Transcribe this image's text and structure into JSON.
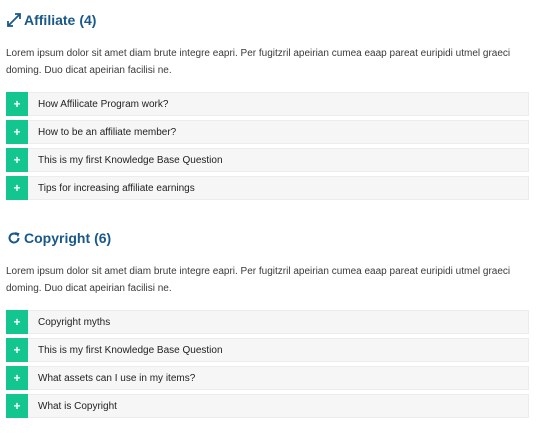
{
  "colors": {
    "accent": "#13c58e",
    "heading": "#19588a",
    "row_bg": "#f6f6f6"
  },
  "sections": [
    {
      "icon": "expand-arrows-icon",
      "title": "Affiliate",
      "count": "(4)",
      "description": "Lorem ipsum dolor sit amet diam brute integre eapri. Per fugitzril apeirian cumea eaap pareat euripidi utmel graeci doming. Duo dicat apeirian facilisi ne.",
      "questions": [
        {
          "toggle": "+",
          "label": "How Affilicate Program work?"
        },
        {
          "toggle": "+",
          "label": "How to be an affiliate member?"
        },
        {
          "toggle": "+",
          "label": "This is my first Knowledge Base Question"
        },
        {
          "toggle": "+",
          "label": "Tips for increasing affiliate earnings"
        }
      ]
    },
    {
      "icon": "refresh-icon",
      "title": "Copyright",
      "count": "(6)",
      "description": "Lorem ipsum dolor sit amet diam brute integre eapri. Per fugitzril apeirian cumea eaap pareat euripidi utmel graeci doming. Duo dicat apeirian facilisi ne.",
      "questions": [
        {
          "toggle": "+",
          "label": "Copyright myths"
        },
        {
          "toggle": "+",
          "label": "This is my first Knowledge Base Question"
        },
        {
          "toggle": "+",
          "label": "What assets can I use in my items?"
        },
        {
          "toggle": "+",
          "label": "What is Copyright"
        }
      ]
    }
  ]
}
